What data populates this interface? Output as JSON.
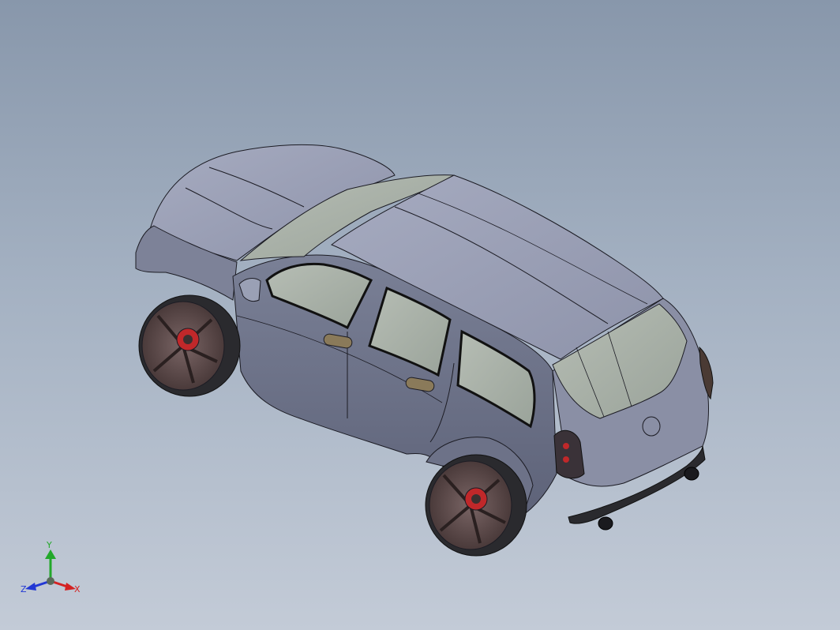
{
  "viewport": {
    "background_top": "#8897ab",
    "background_bottom": "#c3cbd7"
  },
  "model": {
    "body_color": "#8e93aa",
    "edge_color": "#1c1c24",
    "glass_color": "#a9b2a8",
    "rim_color": "#5e4b4b",
    "tire_color": "#2a2a2e",
    "brake_color": "#c0282a"
  },
  "triad": {
    "x_label": "X",
    "y_label": "Y",
    "z_label": "Z",
    "x_color": "#d42222",
    "y_color": "#22a82a",
    "z_color": "#2238d4"
  }
}
